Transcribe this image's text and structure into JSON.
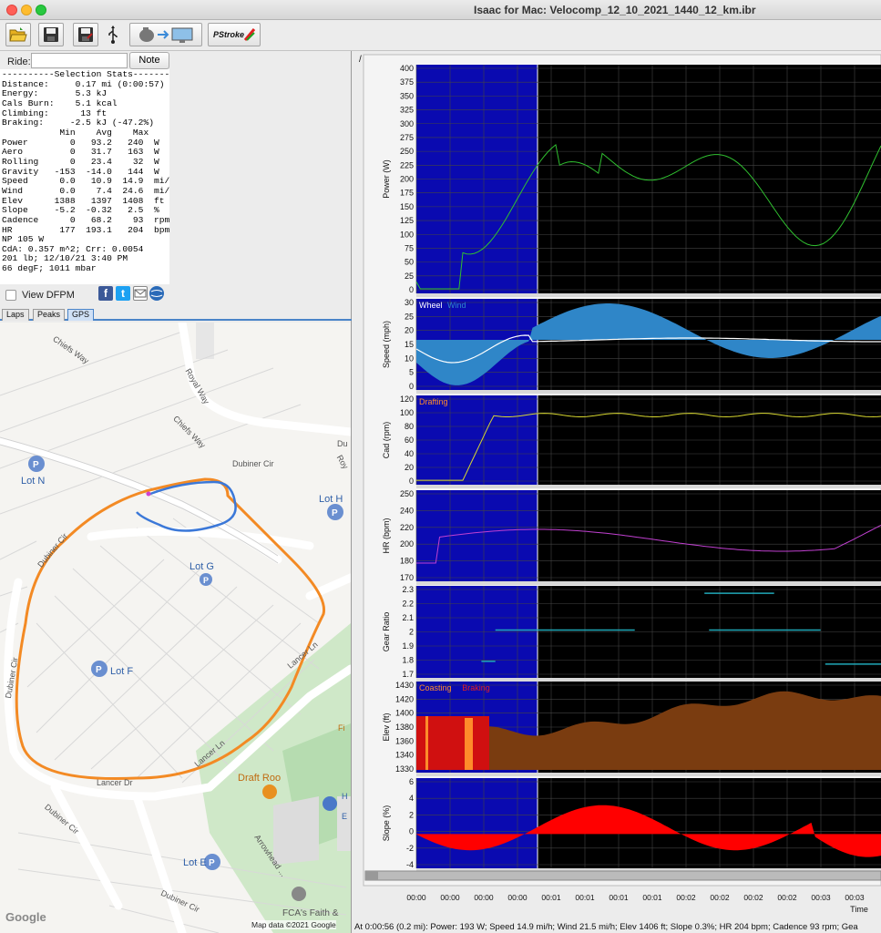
{
  "window": {
    "title": "Isaac for Mac:  Velocomp_12_10_2021_1440_12_km.ibr"
  },
  "toolbar": {
    "items": [
      "open-folder",
      "save",
      "save-as",
      "usb",
      "transfer-to-computer",
      "pstroke"
    ],
    "pstroke_label": "PStroke"
  },
  "ride": {
    "label": "Ride:",
    "value": "",
    "note_label": "Note"
  },
  "stats": {
    "lines": [
      "----------Selection Stats---------",
      "Distance:     0.17 mi (0:00:57)",
      "Energy:       5.3 kJ",
      "Cals Burn:    5.1 kcal",
      "Climbing:      13 ft",
      "Braking:     -2.5 kJ (-47.2%)",
      "           Min    Avg    Max",
      "Power        0   93.2   240  W",
      "Aero         0   31.7   163  W",
      "Rolling      0   23.4    32  W",
      "Gravity   -153  -14.0   144  W",
      "Speed      0.0   10.9  14.9  mi/h",
      "Wind       0.0    7.4  24.6  mi/h",
      "Elev      1388   1397  1408  ft",
      "Slope     -5.2  -0.32   2.5  %",
      "Cadence      0   68.2    93  rpm",
      "HR         177  193.1   204  bpm",
      "NP 105 W",
      "CdA: 0.357 m^2; Crr: 0.0054",
      "201 lb; 12/10/21 3:40 PM",
      "66 degF; 1011 mbar"
    ]
  },
  "options": {
    "view_dfpm_label": "View DFPM",
    "view_dfpm_checked": false
  },
  "tabs": [
    "Laps",
    "Peaks",
    "GPS"
  ],
  "active_tab": "GPS",
  "map": {
    "streets": [
      "Chiefs Way",
      "Royal Way",
      "Chiefs Way",
      "Dubiner Cir",
      "Dubiner Cir",
      "Dubiner Cir",
      "Lancer Ln",
      "Lancer Ln",
      "Lancer Dr",
      "Dubiner Cir",
      "Dubiner Cir",
      "Arrowhead ..."
    ],
    "places": [
      "Lot N",
      "Lot H",
      "Lot G",
      "Lot F",
      "Lot E",
      "Draft Roo",
      "FCA's Faith &",
      "Fi",
      "Du",
      "Roy",
      "H",
      "E"
    ],
    "logo": "Google",
    "attribution": "Map data ©2021 Google"
  },
  "charts": {
    "panel_label": "/",
    "panels": [
      {
        "id": "power",
        "ylabel": "Power (W)",
        "ticks": [
          "400",
          "375",
          "350",
          "325",
          "300",
          "275",
          "250",
          "225",
          "200",
          "175",
          "150",
          "125",
          "100",
          "75",
          "50",
          "25",
          "0"
        ],
        "legend": []
      },
      {
        "id": "speed",
        "ylabel": "Speed (mph)",
        "ticks": [
          "30",
          "25",
          "20",
          "15",
          "10",
          "5",
          "0"
        ],
        "legend": [
          {
            "text": "Wheel",
            "color": "#ffffff"
          },
          {
            "text": "Wind",
            "color": "#2f86c8"
          }
        ]
      },
      {
        "id": "cad",
        "ylabel": "Cad (rpm)",
        "ticks": [
          "120",
          "100",
          "80",
          "60",
          "40",
          "20",
          "0"
        ],
        "legend": [
          {
            "text": "Drafting",
            "color": "#ff8c2a"
          }
        ]
      },
      {
        "id": "hr",
        "ylabel": "HR (bpm)",
        "ticks": [
          "250",
          "240",
          "220",
          "200",
          "180",
          "170"
        ],
        "legend": []
      },
      {
        "id": "gear",
        "ylabel": "Gear Ratio",
        "ticks": [
          "2.3",
          "2.2",
          "2.1",
          "2",
          "1.9",
          "1.8",
          "1.7"
        ],
        "legend": []
      },
      {
        "id": "elev",
        "ylabel": "Elev (ft)",
        "ticks": [
          "1430",
          "1420",
          "1400",
          "1380",
          "1360",
          "1340",
          "1330"
        ],
        "legend": [
          {
            "text": "Coasting",
            "color": "#ff8c2a"
          },
          {
            "text": "Braking",
            "color": "#e02020"
          }
        ]
      },
      {
        "id": "slope",
        "ylabel": "Slope (%)",
        "ticks": [
          "6",
          "4",
          "2",
          "0",
          "-2",
          "-4"
        ],
        "legend": []
      }
    ],
    "x_ticks": [
      "00:00",
      "00:00",
      "00:00",
      "00:00",
      "00:01",
      "00:01",
      "00:01",
      "00:01",
      "00:02",
      "00:02",
      "00:02",
      "00:02",
      "00:03",
      "00:03"
    ],
    "x_label": "Time",
    "colors": {
      "selection": "#0a0ab0",
      "power": "#30c030",
      "cad": "#d8d830",
      "hr": "#c040d0",
      "gear": "#20a8b8",
      "elev": "#7a3c10",
      "slope": "#ff0000"
    }
  },
  "status": {
    "text": "At 0:00:56 (0.2 mi): Power: 193 W; Speed 14.9 mi/h; Wind 21.5 mi/h; Elev 1406 ft; Slope 0.3%; HR 204 bpm; Cadence 93 rpm; Gea"
  }
}
